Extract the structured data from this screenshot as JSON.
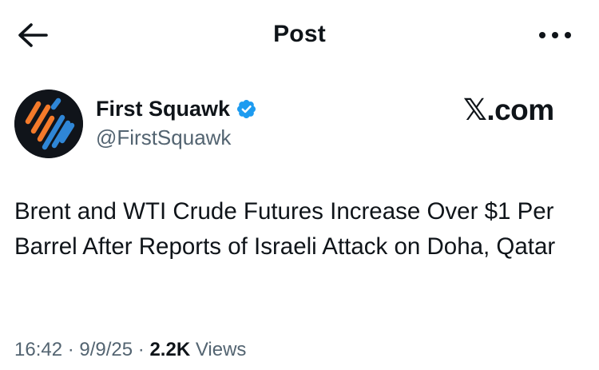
{
  "header": {
    "title": "Post",
    "back_icon": "arrow-left-icon",
    "more_icon": "more-horizontal-icon"
  },
  "author": {
    "name": "First Squawk",
    "handle": "@FirstSquawk",
    "verified": true,
    "verified_color": "#1d9bf0"
  },
  "source_mark": {
    "x": "𝕏",
    "domain": ".com"
  },
  "post": {
    "text": "Brent and WTI Crude Futures Increase Over $1 Per Barrel After Reports of Israeli Attack on Doha, Qatar"
  },
  "meta": {
    "time": "16:42",
    "separator": " · ",
    "date": "9/9/25",
    "views_count": "2.2K",
    "views_label": " Views"
  },
  "colors": {
    "text_primary": "#0f1419",
    "text_secondary": "#536471",
    "avatar_bg": "#10141a",
    "avatar_orange": "#f47a2a",
    "avatar_blue": "#2f86d6"
  }
}
